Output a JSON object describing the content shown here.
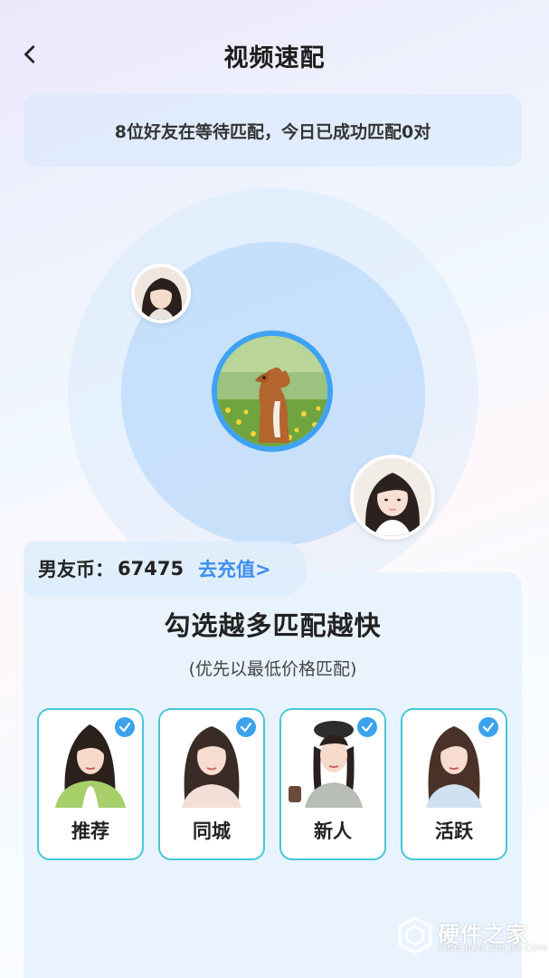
{
  "header": {
    "title": "视频速配"
  },
  "notice": {
    "text": "8位好友在等待匹配，今日已成功匹配0对"
  },
  "wallet": {
    "label": "男友币：",
    "value": "67475",
    "recharge_label": "去充值>"
  },
  "panel": {
    "title": "勾选越多匹配越快",
    "subtitle": "(优先以最低价格匹配)",
    "options": [
      {
        "label": "推荐",
        "checked": true
      },
      {
        "label": "同城",
        "checked": true
      },
      {
        "label": "新人",
        "checked": true
      },
      {
        "label": "活跃",
        "checked": true
      }
    ]
  },
  "watermark": {
    "title": "硬件之家",
    "subtitle": "YING JIAN ZHI JIA.COM"
  },
  "colors": {
    "accent": "#3d8ef0",
    "card_border": "#46c7d8",
    "check": "#3aa3ec",
    "center_ring": "#3fa2f2"
  }
}
